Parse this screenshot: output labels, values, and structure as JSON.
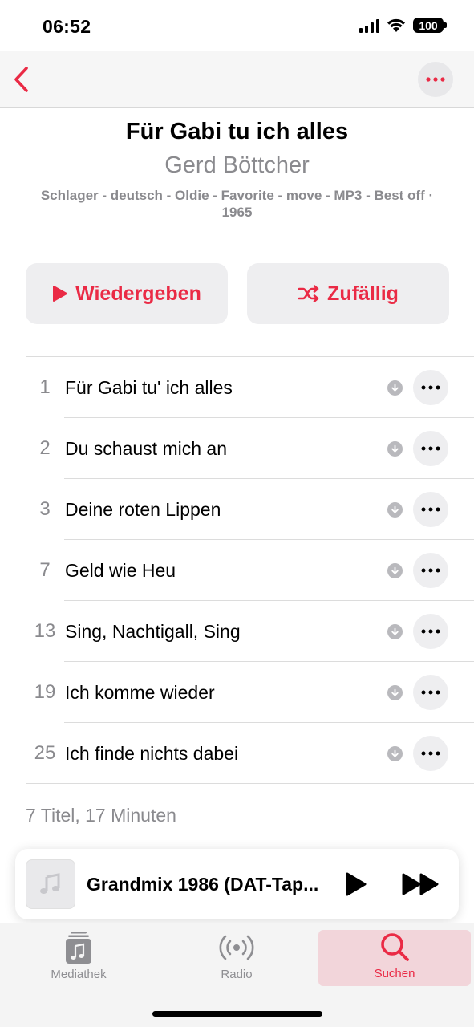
{
  "status_bar": {
    "time": "06:52",
    "battery": "100"
  },
  "nav": {
    "back_icon": "chevron-left-icon",
    "more_icon": "ellipsis-icon"
  },
  "album": {
    "title": "Für Gabi tu ich alles",
    "artist": "Gerd Böttcher",
    "meta": "Schlager - deutsch - Oldie - Favorite - move - MP3 - Best off · 1965"
  },
  "actions": {
    "play_label": "Wiedergeben",
    "shuffle_label": "Zufällig"
  },
  "tracks": [
    {
      "number": "1",
      "title": "Für Gabi tu' ich alles"
    },
    {
      "number": "2",
      "title": "Du schaust mich an"
    },
    {
      "number": "3",
      "title": "Deine roten Lippen"
    },
    {
      "number": "7",
      "title": "Geld wie Heu"
    },
    {
      "number": "13",
      "title": "Sing, Nachtigall, Sing"
    },
    {
      "number": "19",
      "title": "Ich komme wieder"
    },
    {
      "number": "25",
      "title": "Ich finde nichts dabei"
    }
  ],
  "summary": "7 Titel, 17 Minuten",
  "mini_player": {
    "title": "Grandmix 1986 (DAT-Tap..."
  },
  "tabs": [
    {
      "label": "Mediathek",
      "icon": "library-icon"
    },
    {
      "label": "Radio",
      "icon": "radio-icon"
    },
    {
      "label": "Suchen",
      "icon": "search-icon",
      "active": true
    }
  ],
  "colors": {
    "accent": "#ea2a45",
    "secondary_text": "#8a8a8e",
    "button_bg": "#eeeef0"
  }
}
